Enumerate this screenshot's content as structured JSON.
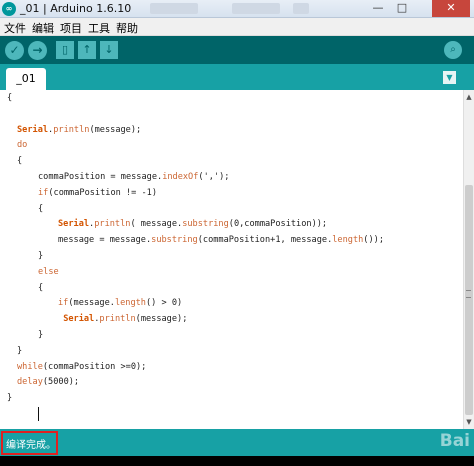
{
  "window": {
    "title": "_01 | Arduino 1.6.10",
    "controls": {
      "minimize": "—",
      "maximize": "□",
      "close": "✕"
    }
  },
  "menu": [
    "文件",
    "编辑",
    "项目",
    "工具",
    "帮助"
  ],
  "toolbar": {
    "icons": [
      "verify-icon",
      "upload-icon",
      "new-icon",
      "open-icon",
      "save-icon",
      "serial-monitor-icon"
    ],
    "glyphs": {
      "verify": "✓",
      "upload": "→",
      "new": "▯",
      "open": "↑",
      "save": "↓",
      "serial": "⌕"
    }
  },
  "tabs": [
    {
      "label": "_01"
    }
  ],
  "tab_menu_glyph": "▼",
  "editor": {
    "lines": [
      {
        "indent": 0,
        "parts": [
          [
            "t",
            "{"
          ]
        ]
      },
      {
        "indent": 0,
        "parts": []
      },
      {
        "indent": 1,
        "parts": [
          [
            "k2",
            "Serial"
          ],
          [
            "t",
            "."
          ],
          [
            "f",
            "println"
          ],
          [
            "t",
            "(message);"
          ]
        ]
      },
      {
        "indent": 1,
        "parts": [
          [
            "k",
            "do"
          ]
        ]
      },
      {
        "indent": 1,
        "parts": [
          [
            "t",
            "{"
          ]
        ]
      },
      {
        "indent": 2,
        "parts": [
          [
            "t",
            "commaPosition = message."
          ],
          [
            "f",
            "indexOf"
          ],
          [
            "t",
            "(',');"
          ]
        ]
      },
      {
        "indent": 2,
        "parts": [
          [
            "k",
            "if"
          ],
          [
            "t",
            "(commaPosition != -1)"
          ]
        ]
      },
      {
        "indent": 2,
        "parts": [
          [
            "t",
            "{"
          ]
        ]
      },
      {
        "indent": 3,
        "parts": [
          [
            "k2",
            "Serial"
          ],
          [
            "t",
            "."
          ],
          [
            "f",
            "println"
          ],
          [
            "t",
            "( message."
          ],
          [
            "f",
            "substring"
          ],
          [
            "t",
            "(0,commaPosition));"
          ]
        ]
      },
      {
        "indent": 3,
        "parts": [
          [
            "t",
            "message = message."
          ],
          [
            "f",
            "substring"
          ],
          [
            "t",
            "(commaPosition+1, message."
          ],
          [
            "f",
            "length"
          ],
          [
            "t",
            "());"
          ]
        ]
      },
      {
        "indent": 2,
        "parts": [
          [
            "t",
            "}"
          ]
        ]
      },
      {
        "indent": 2,
        "parts": [
          [
            "k",
            "else"
          ]
        ]
      },
      {
        "indent": 2,
        "parts": [
          [
            "t",
            "{"
          ]
        ]
      },
      {
        "indent": 3,
        "parts": [
          [
            "k",
            "if"
          ],
          [
            "t",
            "(message."
          ],
          [
            "f",
            "length"
          ],
          [
            "t",
            "() > 0)"
          ]
        ]
      },
      {
        "indent": 3,
        "parts": [
          [
            "t",
            " "
          ],
          [
            "k2",
            "Serial"
          ],
          [
            "t",
            "."
          ],
          [
            "f",
            "println"
          ],
          [
            "t",
            "(message);"
          ]
        ]
      },
      {
        "indent": 2,
        "parts": [
          [
            "t",
            "}"
          ]
        ]
      },
      {
        "indent": 1,
        "parts": [
          [
            "t",
            "}"
          ]
        ]
      },
      {
        "indent": 1,
        "parts": [
          [
            "k",
            "while"
          ],
          [
            "t",
            "(commaPosition >=0);"
          ]
        ]
      },
      {
        "indent": 1,
        "parts": [
          [
            "f",
            "delay"
          ],
          [
            "t",
            "(5000);"
          ]
        ]
      },
      {
        "indent": 0,
        "parts": [
          [
            "t",
            "}"
          ]
        ]
      }
    ]
  },
  "status": {
    "message": "编译完成。"
  },
  "watermark": "Bai"
}
